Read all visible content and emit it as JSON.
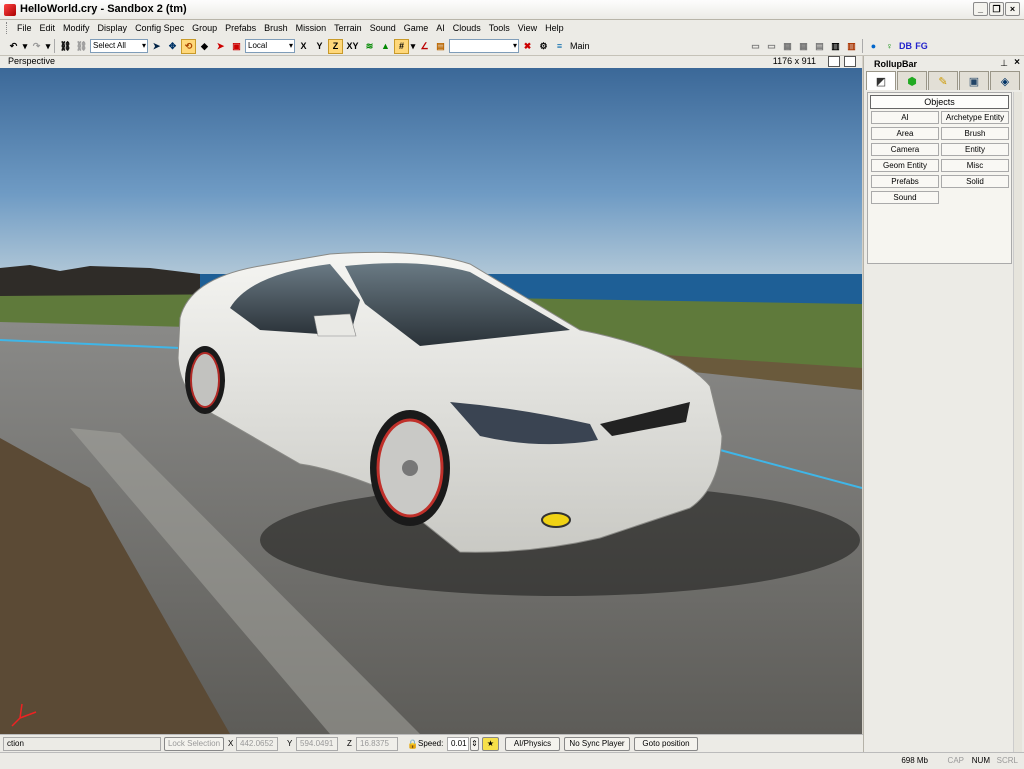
{
  "window": {
    "title": "HelloWorld.cry - Sandbox 2 (tm)"
  },
  "menu": [
    "File",
    "Edit",
    "Modify",
    "Display",
    "Config Spec",
    "Group",
    "Prefabs",
    "Brush",
    "Mission",
    "Terrain",
    "Sound",
    "Game",
    "AI",
    "Clouds",
    "Tools",
    "View",
    "Help"
  ],
  "toolbar": {
    "select_combo": "Select All",
    "coord_combo": "Local",
    "axes": [
      "X",
      "Y",
      "Z",
      "XY"
    ],
    "layer_combo": "",
    "layer_label": "Main",
    "right_labels": [
      "DB",
      "FG"
    ]
  },
  "viewport": {
    "title": "Perspective",
    "resolution": "1176 x 911"
  },
  "rollup": {
    "title": "RollupBar",
    "header_button": "Objects",
    "buttons": [
      "AI",
      "Archetype Entity",
      "Area",
      "Brush",
      "Camera",
      "Entity",
      "Geom Entity",
      "Misc",
      "Prefabs",
      "Solid",
      "Sound"
    ]
  },
  "status": {
    "message": "ction",
    "lock_selection": "Lock Selection",
    "x_label": "X",
    "x_value": "442.0652",
    "y_label": "Y",
    "y_value": "594.0491",
    "z_label": "Z",
    "z_value": "16.8375",
    "speed_label": "Speed:",
    "speed_value": "0.01",
    "ai_physics": "AI/Physics",
    "no_sync_player": "No Sync Player",
    "goto_position": "Goto position"
  },
  "bottom": {
    "memory": "698 Mb",
    "cap": "CAP",
    "num": "NUM",
    "scrl": "SCRL"
  },
  "colors": {
    "chrome": "#ecebe6",
    "sky_top": "#3f6b9d",
    "sky_bottom": "#a8c3d6",
    "sea": "#1e6ea8",
    "grass": "#5d7b3a",
    "car_body": "#e8e8e4",
    "active_tool": "#ffd87a"
  }
}
